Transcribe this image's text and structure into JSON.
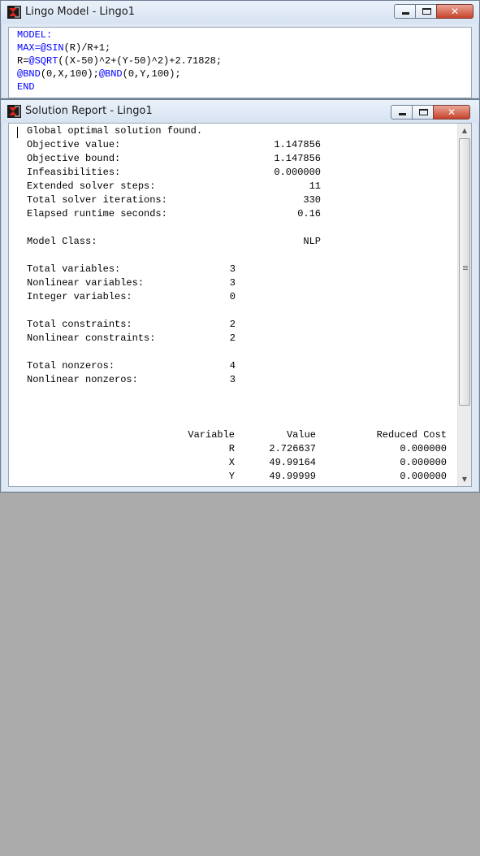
{
  "model_window": {
    "title": "Lingo Model - Lingo1",
    "code_lines": [
      {
        "kw": "MODEL:",
        "rest": ""
      },
      {
        "kw": "MAX=@SIN",
        "rest": "(R)/R+1;"
      },
      {
        "kw": "",
        "pre": "R=",
        "kw2": "@SQRT",
        "rest": "((X-50)^2+(Y-50)^2)+2.71828;"
      },
      {
        "kw": "@BND",
        "rest": "(0,X,100);",
        "kw3": "@BND",
        "rest3": "(0,Y,100);"
      },
      {
        "kw": "END",
        "rest": ""
      }
    ]
  },
  "report_window": {
    "title": "Solution Report - Lingo1",
    "status": "Global optimal solution found.",
    "solver_stats": [
      {
        "label": "Objective value:",
        "value": "1.147856"
      },
      {
        "label": "Objective bound:",
        "value": "1.147856"
      },
      {
        "label": "Infeasibilities:",
        "value": "0.000000"
      },
      {
        "label": "Extended solver steps:",
        "value": "11"
      },
      {
        "label": "Total solver iterations:",
        "value": "330"
      },
      {
        "label": "Elapsed runtime seconds:",
        "value": "0.16"
      }
    ],
    "model_class": {
      "label": "Model Class:",
      "value": "NLP"
    },
    "variables": [
      {
        "label": "Total variables:",
        "value": "3"
      },
      {
        "label": "Nonlinear variables:",
        "value": "3"
      },
      {
        "label": "Integer variables:",
        "value": "0"
      }
    ],
    "constraints": [
      {
        "label": "Total constraints:",
        "value": "2"
      },
      {
        "label": "Nonlinear constraints:",
        "value": "2"
      }
    ],
    "nonzeros": [
      {
        "label": "Total nonzeros:",
        "value": "4"
      },
      {
        "label": "Nonlinear nonzeros:",
        "value": "3"
      }
    ],
    "table": {
      "headers": [
        "Variable",
        "Value",
        "Reduced Cost"
      ],
      "rows": [
        [
          "R",
          "2.726637",
          "0.000000"
        ],
        [
          "X",
          "49.99164",
          "0.000000"
        ],
        [
          "Y",
          "49.99999",
          "0.000000"
        ]
      ]
    }
  },
  "window_buttons": {
    "close": "✕"
  }
}
